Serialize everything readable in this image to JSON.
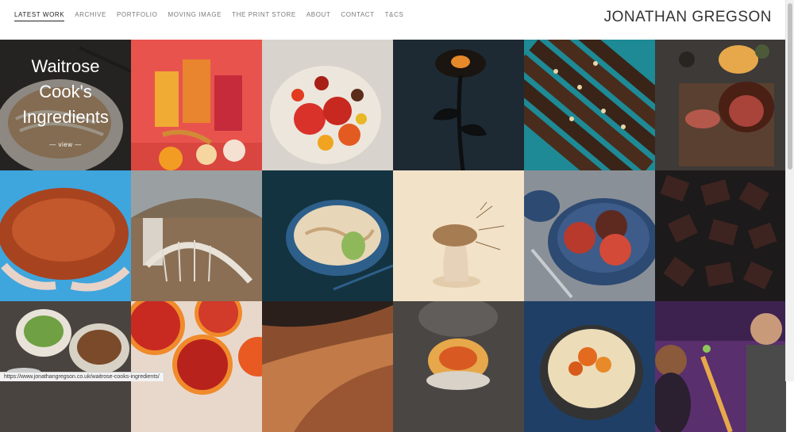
{
  "nav": {
    "items": [
      {
        "label": "LATEST WORK"
      },
      {
        "label": "ARCHIVE"
      },
      {
        "label": "PORTFOLIO"
      },
      {
        "label": "MOVING IMAGE"
      },
      {
        "label": "THE PRINT STORE"
      },
      {
        "label": "ABOUT"
      },
      {
        "label": "CONTACT"
      },
      {
        "label": "T&CS"
      }
    ]
  },
  "site_title": "JONATHAN GREGSON",
  "hover_tile": {
    "title": "Waitrose Cook's Ingredients",
    "view_label": "— view —"
  },
  "status_url": "https://www.jonathangregson.co.uk/waitrose-cooks-ingredients/"
}
